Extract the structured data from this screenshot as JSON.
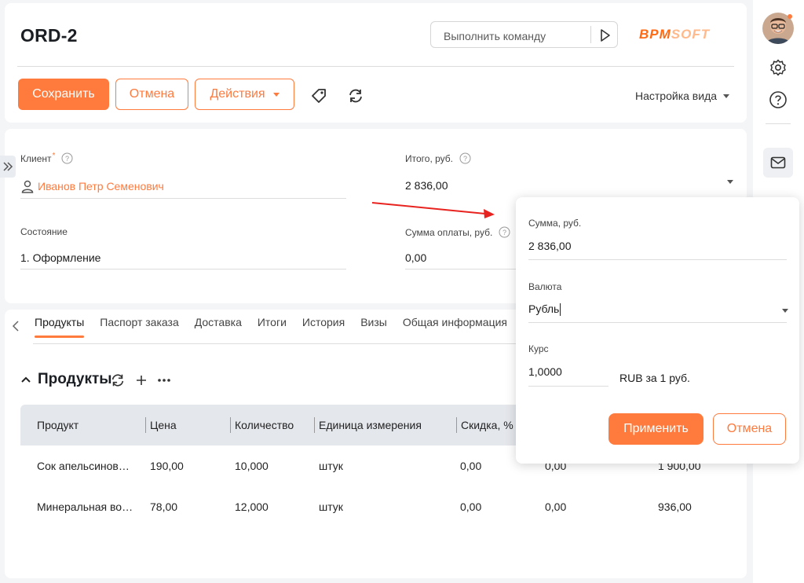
{
  "header": {
    "title": "ORD-2",
    "command_placeholder": "Выполнить команду",
    "logo_part1": "BPM",
    "logo_part2": "SOFT",
    "save_label": "Сохранить",
    "cancel_label": "Отмена",
    "actions_label": "Действия",
    "view_settings_label": "Настройка вида"
  },
  "fields": {
    "client_label": "Клиент",
    "client_required_mark": "*",
    "client_value": "Иванов Петр Семенович",
    "total_label": "Итого, руб.",
    "total_value": "2 836,00",
    "state_label": "Состояние",
    "state_value": "1. Оформление",
    "payment_label": "Сумма оплаты, руб.",
    "payment_value": "0,00"
  },
  "tabs": [
    {
      "label": "Продукты",
      "active": true
    },
    {
      "label": "Паспорт заказа",
      "active": false
    },
    {
      "label": "Доставка",
      "active": false
    },
    {
      "label": "Итоги",
      "active": false
    },
    {
      "label": "История",
      "active": false
    },
    {
      "label": "Визы",
      "active": false
    },
    {
      "label": "Общая информация",
      "active": false
    }
  ],
  "products": {
    "title": "Продукты",
    "columns": [
      "Продукт",
      "Цена",
      "Количество",
      "Единица измерения",
      "Скидка, %"
    ],
    "rows": [
      {
        "product": "Сок апельсинов…",
        "price": "190,00",
        "qty": "10,000",
        "unit": "штук",
        "discount": "0,00",
        "extra": "0,00",
        "total": "1 900,00"
      },
      {
        "product": "Минеральная во…",
        "price": "78,00",
        "qty": "12,000",
        "unit": "штук",
        "discount": "0,00",
        "extra": "0,00",
        "total": "936,00"
      }
    ]
  },
  "popup": {
    "amount_label": "Сумма, руб.",
    "amount_value": "2 836,00",
    "currency_label": "Валюта",
    "currency_value": "Рубль",
    "rate_label": "Курс",
    "rate_value": "1,0000",
    "rate_hint": "RUB за 1 руб.",
    "apply_label": "Применить",
    "cancel_label": "Отмена"
  },
  "colors": {
    "accent": "#ff7a3d",
    "annotation_arrow": "#e8231f"
  },
  "icons": [
    "play-icon",
    "tag-icon",
    "refresh-icon",
    "question-icon",
    "user-icon",
    "chevron-left-icon",
    "double-chevron-right-icon",
    "chevron-up-icon",
    "plus-icon",
    "more-icon",
    "gear-icon",
    "help-icon",
    "mail-icon"
  ]
}
